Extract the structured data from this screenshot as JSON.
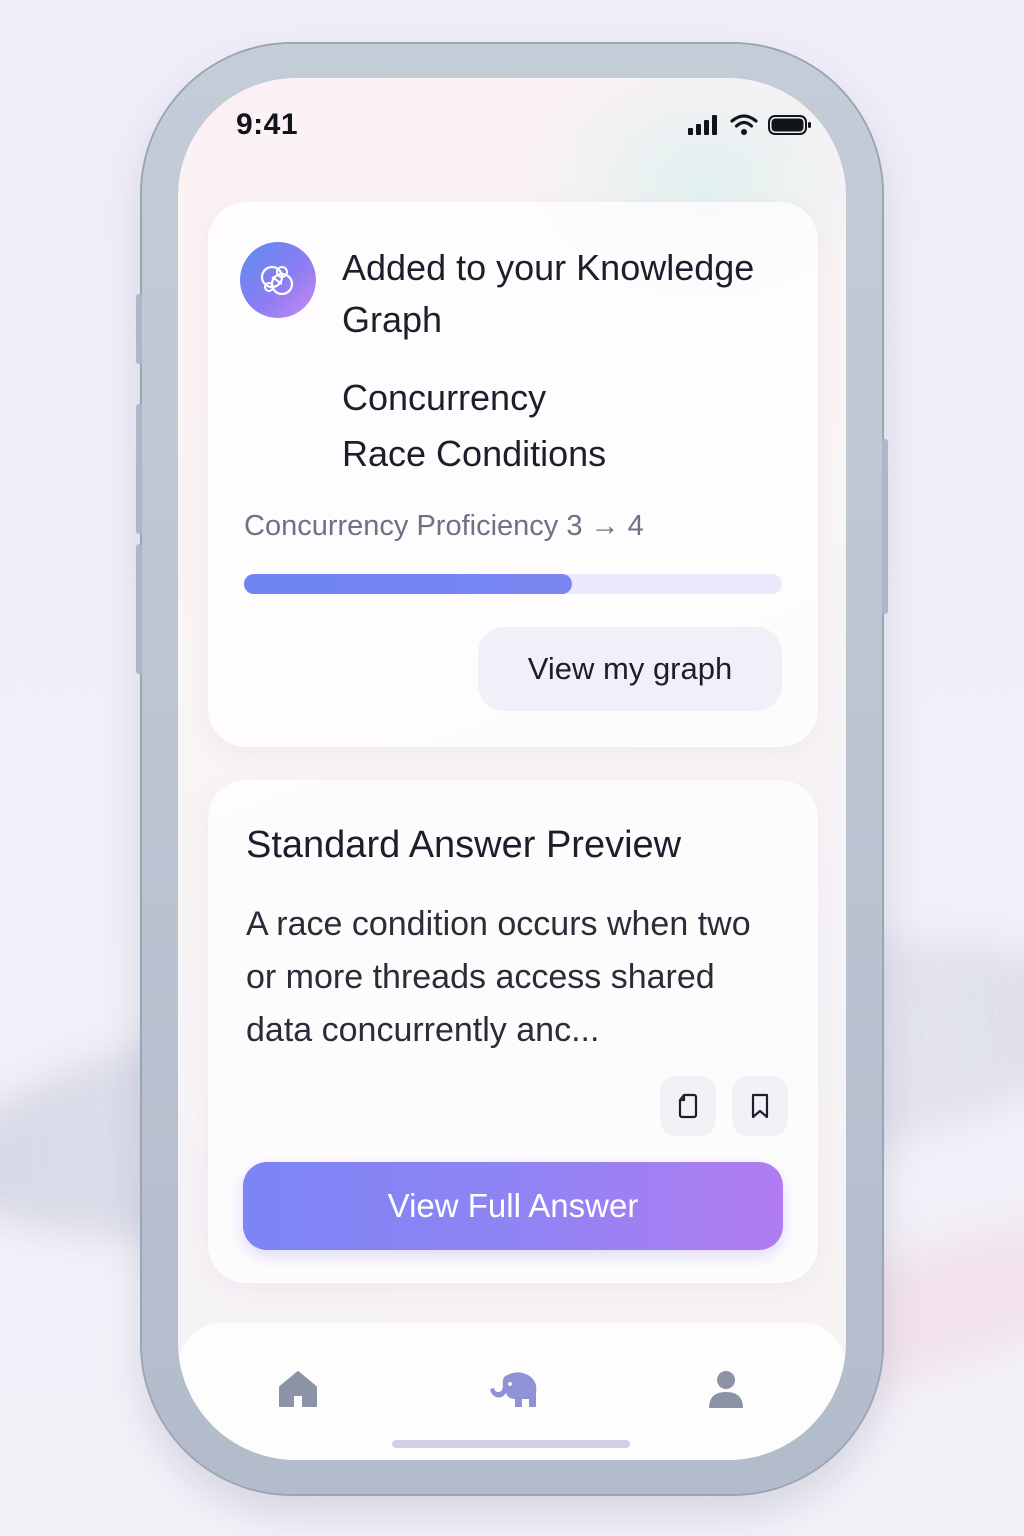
{
  "status_bar": {
    "time": "9:41",
    "icons": [
      "cellular-signal-icon",
      "wifi-icon",
      "battery-icon"
    ]
  },
  "knowledge_card": {
    "icon": "knowledge-graph-icon",
    "title": "Added to your Knowledge Graph",
    "topics": [
      "Concurrency",
      "Race Conditions"
    ],
    "proficiency_label": "Concurrency Proficiency 3 → 4",
    "progress_fraction": 0.61,
    "button_label": "View my graph"
  },
  "answer_card": {
    "title": "Standard Answer Preview",
    "preview_text": "A race condition occurs when two or more threads access shared data concurrently anc...",
    "actions": [
      "copy-icon",
      "bookmark-icon"
    ],
    "button_label": "View Full Answer"
  },
  "tab_bar": {
    "tabs": [
      "home-icon",
      "elephant-icon",
      "profile-icon"
    ],
    "active_tab": "elephant-icon"
  },
  "colors": {
    "accent": "#7c84f6",
    "accent_end": "#b07cf0",
    "progress": "#6d84f1",
    "text_primary": "#1c1f2b",
    "text_secondary": "#6d7385"
  }
}
